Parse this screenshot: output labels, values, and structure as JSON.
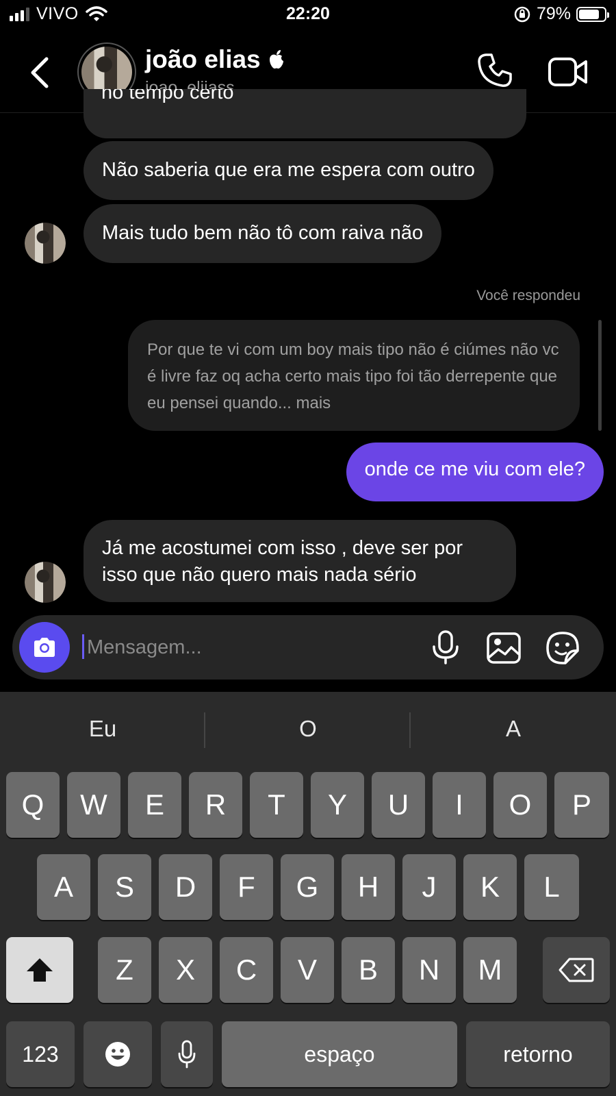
{
  "status_bar": {
    "carrier": "VIVO",
    "time": "22:20",
    "battery": "79%"
  },
  "header": {
    "name": "joão elias",
    "username": "joao_eliiass"
  },
  "messages": {
    "m1": "no tempo certo",
    "m2": "Não saberia que era me espera com outro",
    "m3": "Mais tudo bem não tô com raiva não",
    "replied_label": "Você respondeu",
    "quoted": "Por que te vi com um boy mais tipo não é ciúmes não vc é livre faz oq acha certo mais tipo foi tão derrepente que eu pensei quando... mais",
    "sent": "onde ce me viu com ele?",
    "m4": "Já me acostumei com isso , deve ser por isso que não quero mais nada sério"
  },
  "composer": {
    "placeholder": "Mensagem..."
  },
  "keyboard": {
    "suggestions": [
      "Eu",
      "O",
      "A"
    ],
    "row1": [
      "Q",
      "W",
      "E",
      "R",
      "T",
      "Y",
      "U",
      "I",
      "O",
      "P"
    ],
    "row2": [
      "A",
      "S",
      "D",
      "F",
      "G",
      "H",
      "J",
      "K",
      "L"
    ],
    "row3": [
      "Z",
      "X",
      "C",
      "V",
      "B",
      "N",
      "M"
    ],
    "numbers_key": "123",
    "space_key": "espaço",
    "return_key": "retorno"
  },
  "colors": {
    "sent_bubble": "#6b45e6",
    "received_bubble": "#262626",
    "camera_button": "#5a4bef",
    "background": "#000000"
  },
  "icons": [
    "back-chevron",
    "apple-logo",
    "phone",
    "video-camera",
    "camera",
    "microphone",
    "photo-gallery",
    "sticker",
    "shift-arrow",
    "backspace",
    "emoji",
    "dictation-mic"
  ]
}
